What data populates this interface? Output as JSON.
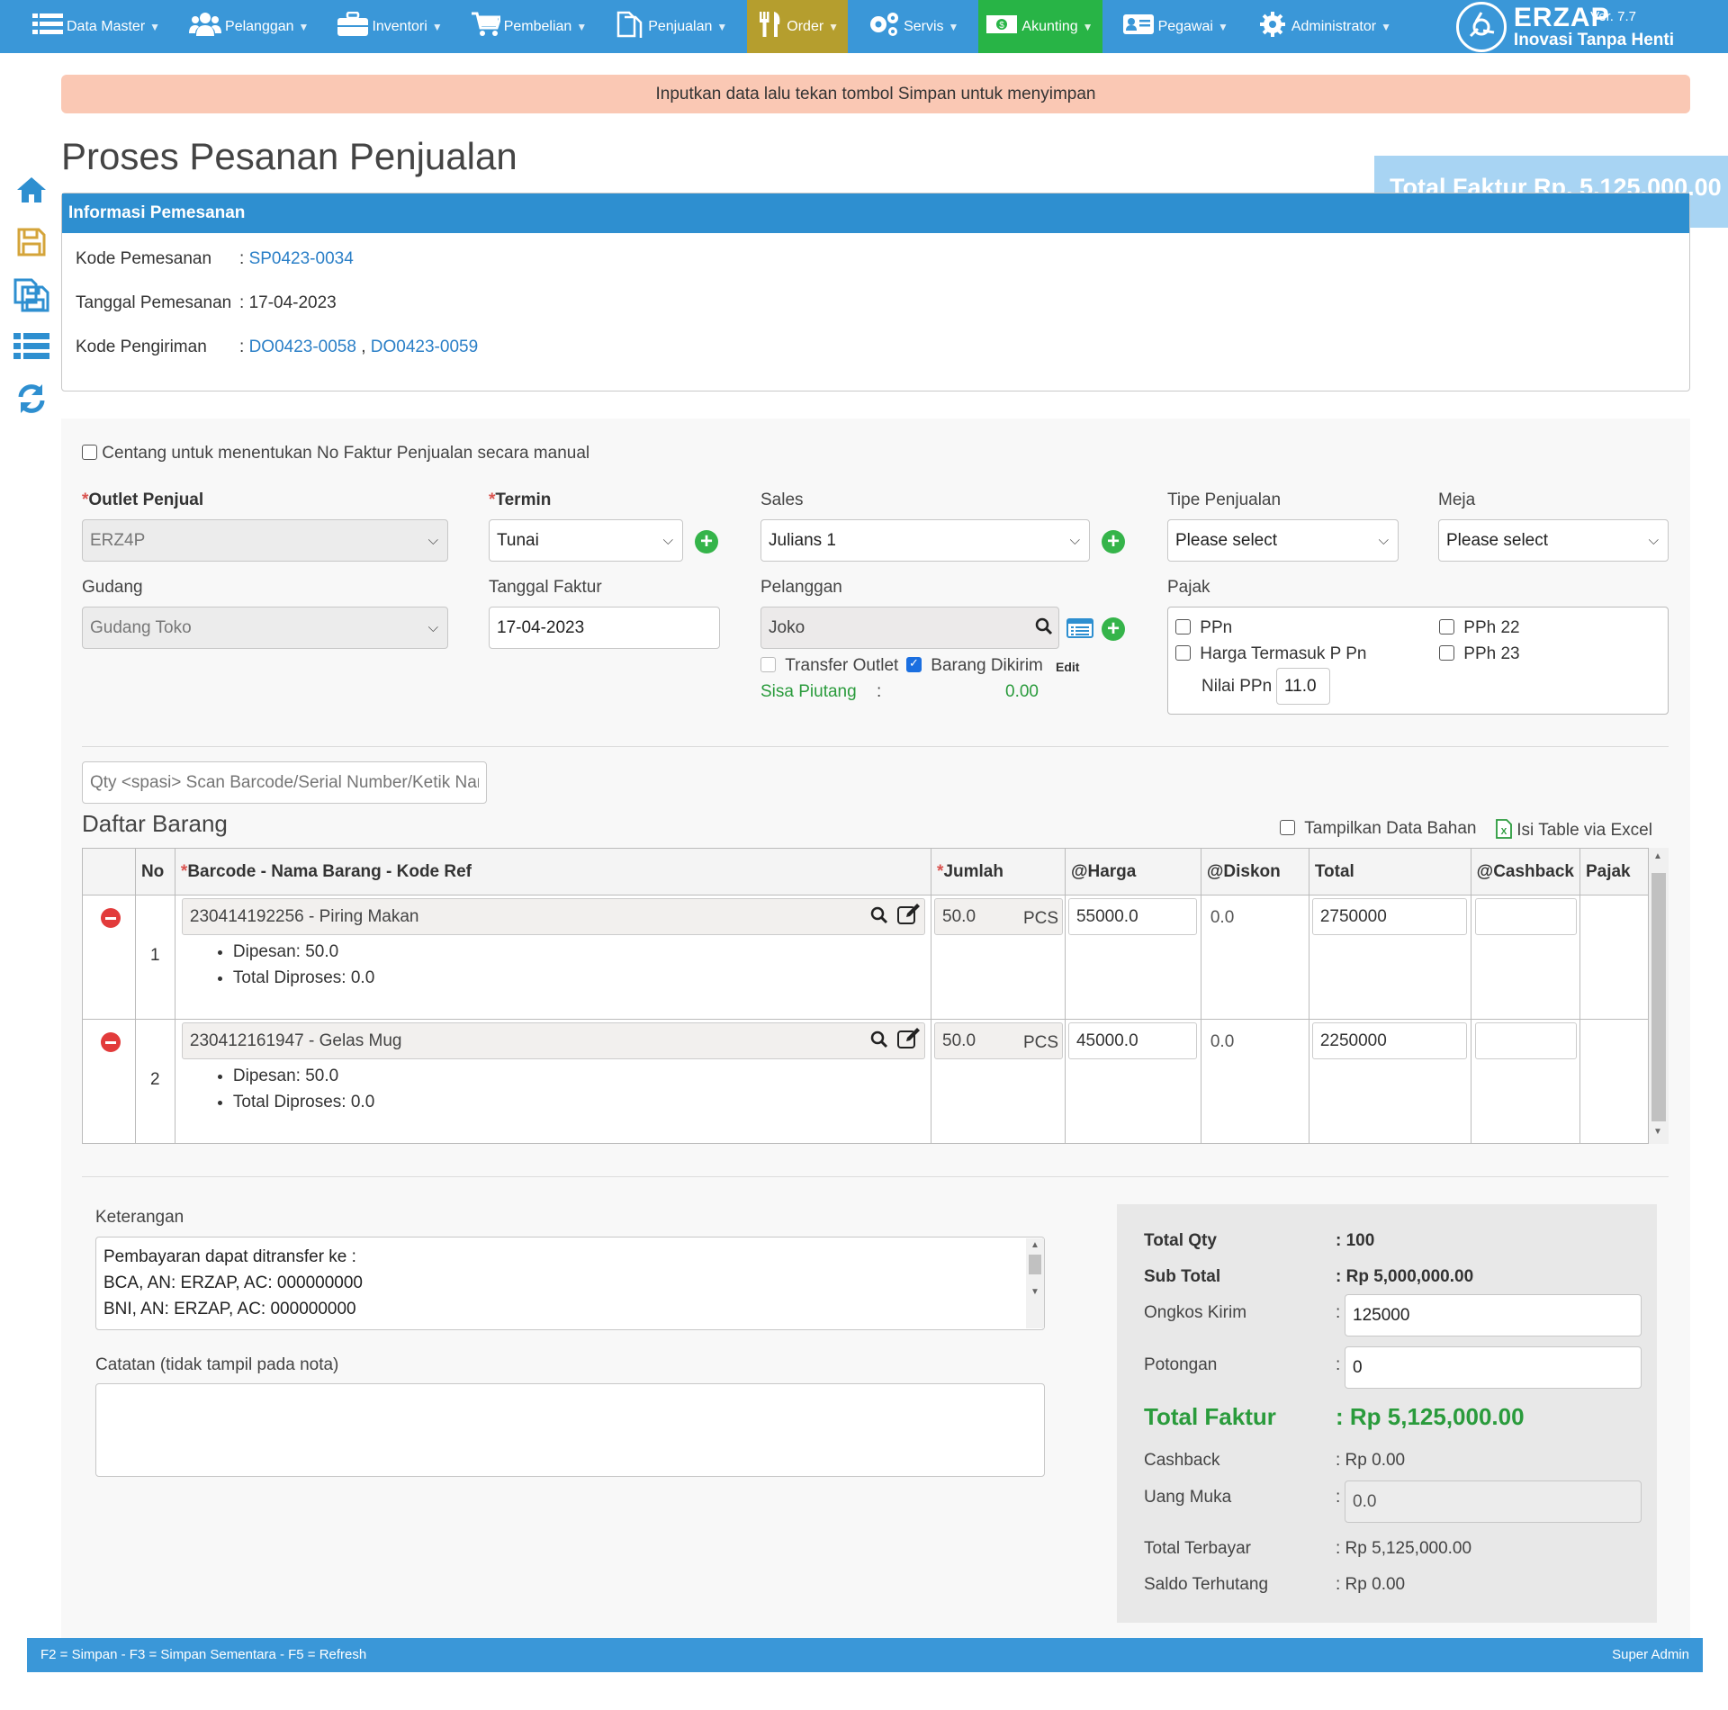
{
  "nav": {
    "items": [
      {
        "label": "Data Master",
        "icon": "list-icon"
      },
      {
        "label": "Pelanggan",
        "icon": "users-icon"
      },
      {
        "label": "Inventori",
        "icon": "briefcase-icon"
      },
      {
        "label": "Pembelian",
        "icon": "cart-icon"
      },
      {
        "label": "Penjualan",
        "icon": "document-icon"
      },
      {
        "label": "Order",
        "icon": "utensils-icon"
      },
      {
        "label": "Servis",
        "icon": "gears-icon"
      },
      {
        "label": "Akunting",
        "icon": "money-icon"
      },
      {
        "label": "Pegawai",
        "icon": "id-card-icon"
      },
      {
        "label": "Administrator",
        "icon": "gear-icon"
      }
    ],
    "brand_name": "ERZAP",
    "brand_tagline": "Inovasi Tanpa Henti",
    "version": "Ver. 7.7",
    "colors": {
      "bar": "#3a97d8",
      "order": "#b59e2e",
      "akunting": "#28b446"
    }
  },
  "alert": {
    "text": "Inputkan data lalu tekan tombol Simpan untuk menyimpan"
  },
  "page": {
    "title": "Proses Pesanan Penjualan",
    "total_float": "Total Faktur  Rp. 5,125,000.00"
  },
  "info": {
    "heading": "Informasi Pemesanan",
    "kode_pemesanan_label": "Kode Pemesanan",
    "kode_pemesanan": "SP0423-0034",
    "tanggal_label": "Tanggal Pemesanan",
    "tanggal": "17-04-2023",
    "kode_pengiriman_label": "Kode Pengiriman",
    "kode_pengiriman": [
      "DO0423-0058",
      "DO0423-0059"
    ]
  },
  "form": {
    "manual_faktur_label": "Centang untuk menentukan No Faktur Penjualan secara manual",
    "outlet_label": "Outlet Penjual",
    "outlet_value": "ERZ4P",
    "termin_label": "Termin",
    "termin_value": "Tunai",
    "sales_label": "Sales",
    "sales_value": "Julians 1",
    "tipe_label": "Tipe Penjualan",
    "tipe_value": "Please select",
    "meja_label": "Meja",
    "meja_value": "Please select",
    "gudang_label": "Gudang",
    "gudang_value": "Gudang Toko",
    "tanggal_faktur_label": "Tanggal Faktur",
    "tanggal_faktur_value": "17-04-2023",
    "pelanggan_label": "Pelanggan",
    "pelanggan_value": "Joko",
    "transfer_outlet_label": "Transfer Outlet",
    "barang_dikirim_label": "Barang Dikirim",
    "edit_label": "Edit",
    "sisa_piutang_label": "Sisa Piutang",
    "sisa_piutang_value": "0.00",
    "pajak_label": "Pajak",
    "ppn_label": "PPn",
    "harga_termasuk_label": "Harga Termasuk P Pn",
    "pph22_label": "PPh 22",
    "pph23_label": "PPh 23",
    "nilai_ppn_label": "Nilai PPn",
    "nilai_ppn_value": "11.0",
    "scan_placeholder": "Qty <spasi> Scan Barcode/Serial Number/Ketik Nama"
  },
  "items": {
    "title": "Daftar Barang",
    "tampilkan_label": "Tampilkan Data Bahan",
    "excel_label": "Isi Table via Excel",
    "headers": {
      "no": "No",
      "barcode": "Barcode - Nama Barang - Kode Ref",
      "jumlah": "Jumlah",
      "harga": "@Harga",
      "diskon": "@Diskon",
      "total": "Total",
      "cashback": "@Cashback",
      "pajak": "Pajak"
    },
    "rows": [
      {
        "no": "1",
        "name": "230414192256 - Piring Makan",
        "qty": "50.0",
        "unit": "PCS",
        "harga": "55000.0",
        "diskon": "0.0",
        "total": "2750000",
        "dipesan": "Dipesan: 50.0",
        "diproses": "Total Diproses: 0.0"
      },
      {
        "no": "2",
        "name": "230412161947 - Gelas Mug",
        "qty": "50.0",
        "unit": "PCS",
        "harga": "45000.0",
        "diskon": "0.0",
        "total": "2250000",
        "dipesan": "Dipesan: 50.0",
        "diproses": "Total Diproses: 0.0"
      }
    ]
  },
  "bottom": {
    "keterangan_label": "Keterangan",
    "keterangan_value": "Pembayaran dapat ditransfer ke :\nBCA, AN: ERZAP, AC: 000000000\nBNI, AN: ERZAP, AC: 000000000",
    "catatan_label": "Catatan (tidak tampil pada nota)",
    "catatan_value": ""
  },
  "summary": {
    "total_qty_label": "Total Qty",
    "total_qty": ": 100",
    "sub_total_label": "Sub Total",
    "sub_total": ": Rp 5,000,000.00",
    "ongkos_label": "Ongkos Kirim",
    "ongkos_value": "125000",
    "potongan_label": "Potongan",
    "potongan_value": "0",
    "total_faktur_label": "Total Faktur",
    "total_faktur": ": Rp 5,125,000.00",
    "cashback_label": "Cashback",
    "cashback": ": Rp 0.00",
    "uang_muka_label": "Uang Muka",
    "uang_muka_value": "0.0",
    "total_terbayar_label": "Total Terbayar",
    "total_terbayar": ": Rp 5,125,000.00",
    "saldo_label": "Saldo Terhutang",
    "saldo": ": Rp 0.00",
    "colon": ":"
  },
  "footer": {
    "shortcuts": "F2 = Simpan - F3 = Simpan Sementara - F5 = Refresh",
    "user": "Super Admin"
  }
}
